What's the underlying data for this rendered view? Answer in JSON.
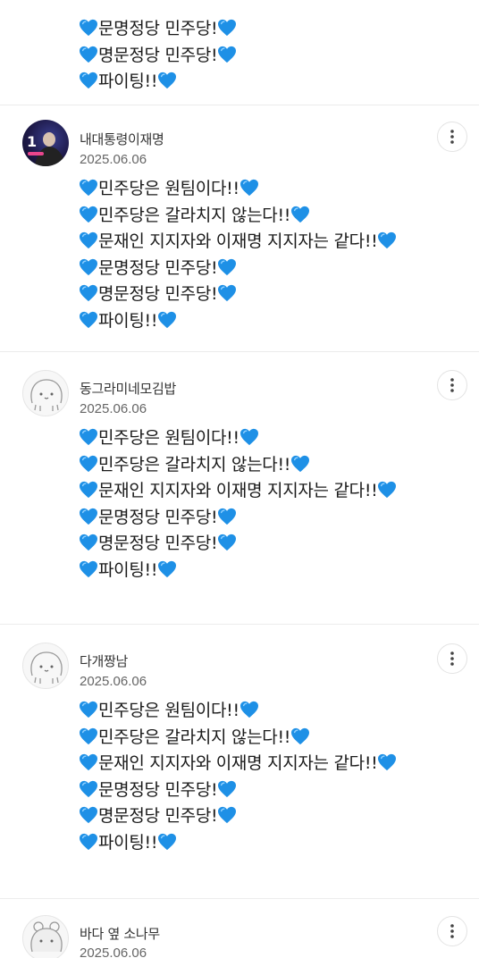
{
  "top_lines": [
    "💙문명정당 민주당!💙",
    "💙명문정당 민주당!💙",
    "💙파이팅!!💙"
  ],
  "comments": [
    {
      "username": "내대통령이재명",
      "date": "2025.06.06",
      "avatar": "photo",
      "lines": [
        "💙민주당은 원팀이다!!💙",
        "💙민주당은 갈라치지 않는다!!💙",
        "💙문재인 지지자와 이재명 지지자는 같다!!💙",
        "💙문명정당 민주당!💙",
        "💙명문정당 민주당!💙",
        "💙파이팅!!💙"
      ]
    },
    {
      "username": "동그라미네모김밥",
      "date": "2025.06.06",
      "avatar": "blank",
      "lines": [
        "💙민주당은 원팀이다!!💙",
        "💙민주당은 갈라치지 않는다!!💙",
        "💙문재인 지지자와 이재명 지지자는 같다!!💙",
        "💙문명정당 민주당!💙",
        "💙명문정당 민주당!💙",
        "💙파이팅!!💙"
      ]
    },
    {
      "username": "다개짱남",
      "date": "2025.06.06",
      "avatar": "blank",
      "lines": [
        "💙민주당은 원팀이다!!💙",
        "💙민주당은 갈라치지 않는다!!💙",
        "💙문재인 지지자와 이재명 지지자는 같다!!💙",
        "💙문명정당 민주당!💙",
        "💙명문정당 민주당!💙",
        "💙파이팅!!💙"
      ]
    },
    {
      "username": "바다 옆 소나무",
      "date": "2025.06.06",
      "avatar": "blank",
      "lines": []
    }
  ],
  "avatar_badge": "1",
  "more_icon": "more-vertical-icon",
  "heart_icon": "blue-heart-icon",
  "colors": {
    "heart": "#1e90e6",
    "divider": "#ececec"
  }
}
